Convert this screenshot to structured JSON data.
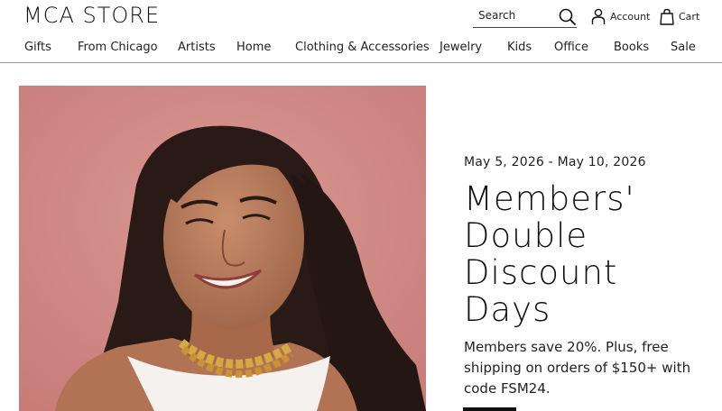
{
  "header": {
    "logo": "MCA STORE",
    "search": {
      "placeholder": "Search"
    },
    "account_label": "Account",
    "cart_label": "Cart"
  },
  "nav": {
    "items": [
      {
        "label": "Gifts"
      },
      {
        "label": "From Chicago"
      },
      {
        "label": "Artists"
      },
      {
        "label": "Home"
      },
      {
        "label": "Clothing & Accessories"
      },
      {
        "label": "Jewelry"
      },
      {
        "label": "Kids"
      },
      {
        "label": "Office"
      },
      {
        "label": "Books"
      },
      {
        "label": "Sale"
      }
    ]
  },
  "hero": {
    "date_range": "May 5, 2026 - May 10, 2026",
    "headline": [
      "Members'",
      "Double",
      "Discount",
      "Days"
    ],
    "description": "Members save 20%. Plus, free shipping on orders of $150+ with code FSM24."
  },
  "colors": {
    "hero_background": "#cf8883",
    "accent": "#111111"
  },
  "icons": [
    "search-icon",
    "account-icon",
    "cart-icon"
  ]
}
